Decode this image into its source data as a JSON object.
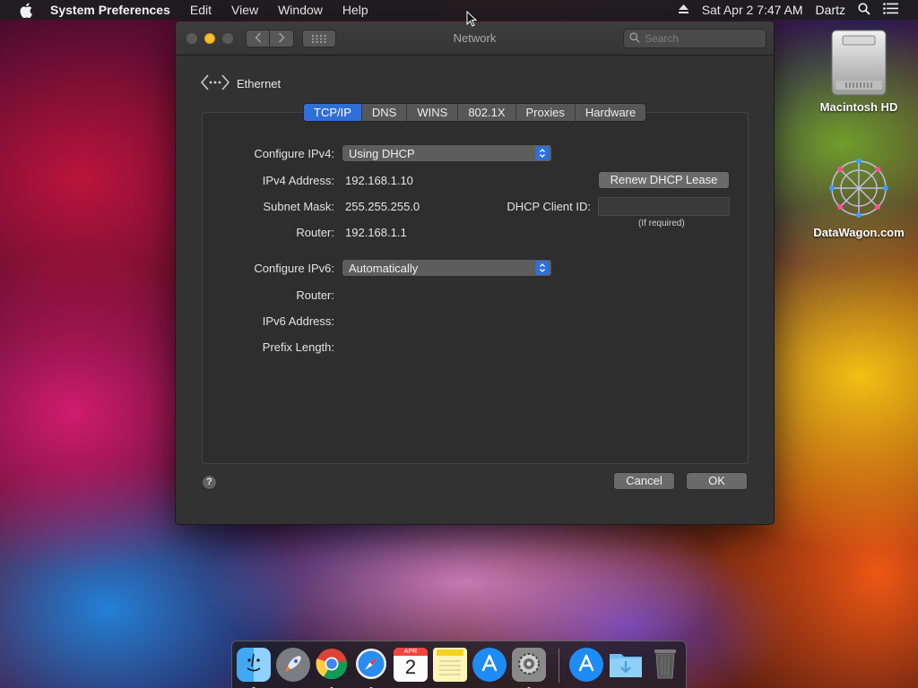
{
  "menubar": {
    "app_name": "System Preferences",
    "items": [
      "Edit",
      "View",
      "Window",
      "Help"
    ],
    "datetime": "Sat Apr 2  7:47 AM",
    "user": "Dartz"
  },
  "window": {
    "title": "Network",
    "search_placeholder": "Search",
    "interface_name": "Ethernet",
    "tabs": [
      "TCP/IP",
      "DNS",
      "WINS",
      "802.1X",
      "Proxies",
      "Hardware"
    ],
    "active_tab": "TCP/IP"
  },
  "tcpip": {
    "configure_ipv4_label": "Configure IPv4:",
    "configure_ipv4_value": "Using DHCP",
    "ipv4_address_label": "IPv4 Address:",
    "ipv4_address_value": "192.168.1.10",
    "subnet_mask_label": "Subnet Mask:",
    "subnet_mask_value": "255.255.255.0",
    "router_label": "Router:",
    "router_value": "192.168.1.1",
    "renew_button": "Renew DHCP Lease",
    "dhcp_client_id_label": "DHCP Client ID:",
    "dhcp_client_id_value": "",
    "if_required_note": "(If required)",
    "configure_ipv6_label": "Configure IPv6:",
    "configure_ipv6_value": "Automatically",
    "ipv6_router_label": "Router:",
    "ipv6_address_label": "IPv6 Address:",
    "prefix_length_label": "Prefix Length:"
  },
  "footer": {
    "help": "?",
    "cancel": "Cancel",
    "ok": "OK"
  },
  "desktop": {
    "icons": [
      "Macintosh HD",
      "DataWagon.com"
    ]
  },
  "dock": {
    "apps": [
      "Finder",
      "Launchpad",
      "Google Chrome",
      "Safari",
      "Calendar",
      "Notes",
      "App Store",
      "System Preferences",
      "App Store",
      "Downloads",
      "Trash"
    ],
    "calendar_month": "APR",
    "calendar_day": "2"
  },
  "colors": {
    "accent": "#2f6fd8",
    "window_bg": "#323232",
    "minimize": "#f5be2b"
  }
}
